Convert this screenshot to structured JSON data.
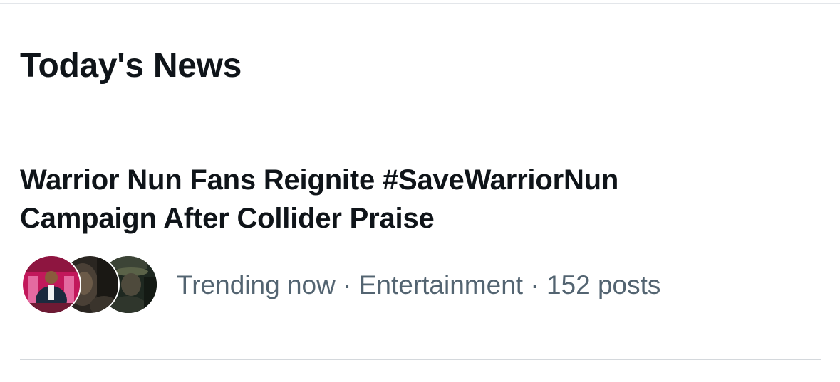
{
  "section": {
    "title": "Today's News"
  },
  "story": {
    "headline_line1": "Warrior Nun Fans Reignite #SaveWarriorNun",
    "headline_line2": "Campaign After Collider Praise",
    "status": "Trending now",
    "separator": " · ",
    "category": "Entertainment",
    "post_count": "152 posts"
  },
  "colors": {
    "text_primary": "#0f1419",
    "text_secondary": "#536471",
    "divider": "#e3e6ea"
  }
}
